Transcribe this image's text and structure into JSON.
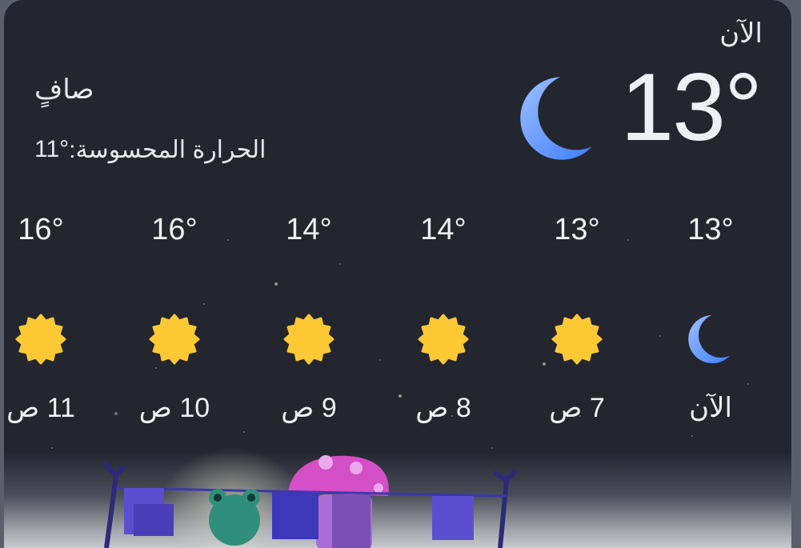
{
  "current": {
    "label": "الآن",
    "temp": "13°",
    "icon": "moon-icon",
    "condition": "صافٍ",
    "feels_like_label": "الحرارة المحسوسة:",
    "feels_like_value": "11°"
  },
  "hourly": [
    {
      "label": "الآن",
      "temp": "13°",
      "icon": "moon-icon"
    },
    {
      "label": "7 ص",
      "temp": "13°",
      "icon": "sun-icon"
    },
    {
      "label": "8 ص",
      "temp": "14°",
      "icon": "sun-icon"
    },
    {
      "label": "9 ص",
      "temp": "14°",
      "icon": "sun-icon"
    },
    {
      "label": "10 ص",
      "temp": "16°",
      "icon": "sun-icon"
    },
    {
      "label": "11 ص",
      "temp": "16°",
      "icon": "sun-icon"
    }
  ],
  "colors": {
    "background": "#23262f",
    "moon": "#5f97ff",
    "sun": "#fcc934",
    "text": "#eef0f5"
  }
}
